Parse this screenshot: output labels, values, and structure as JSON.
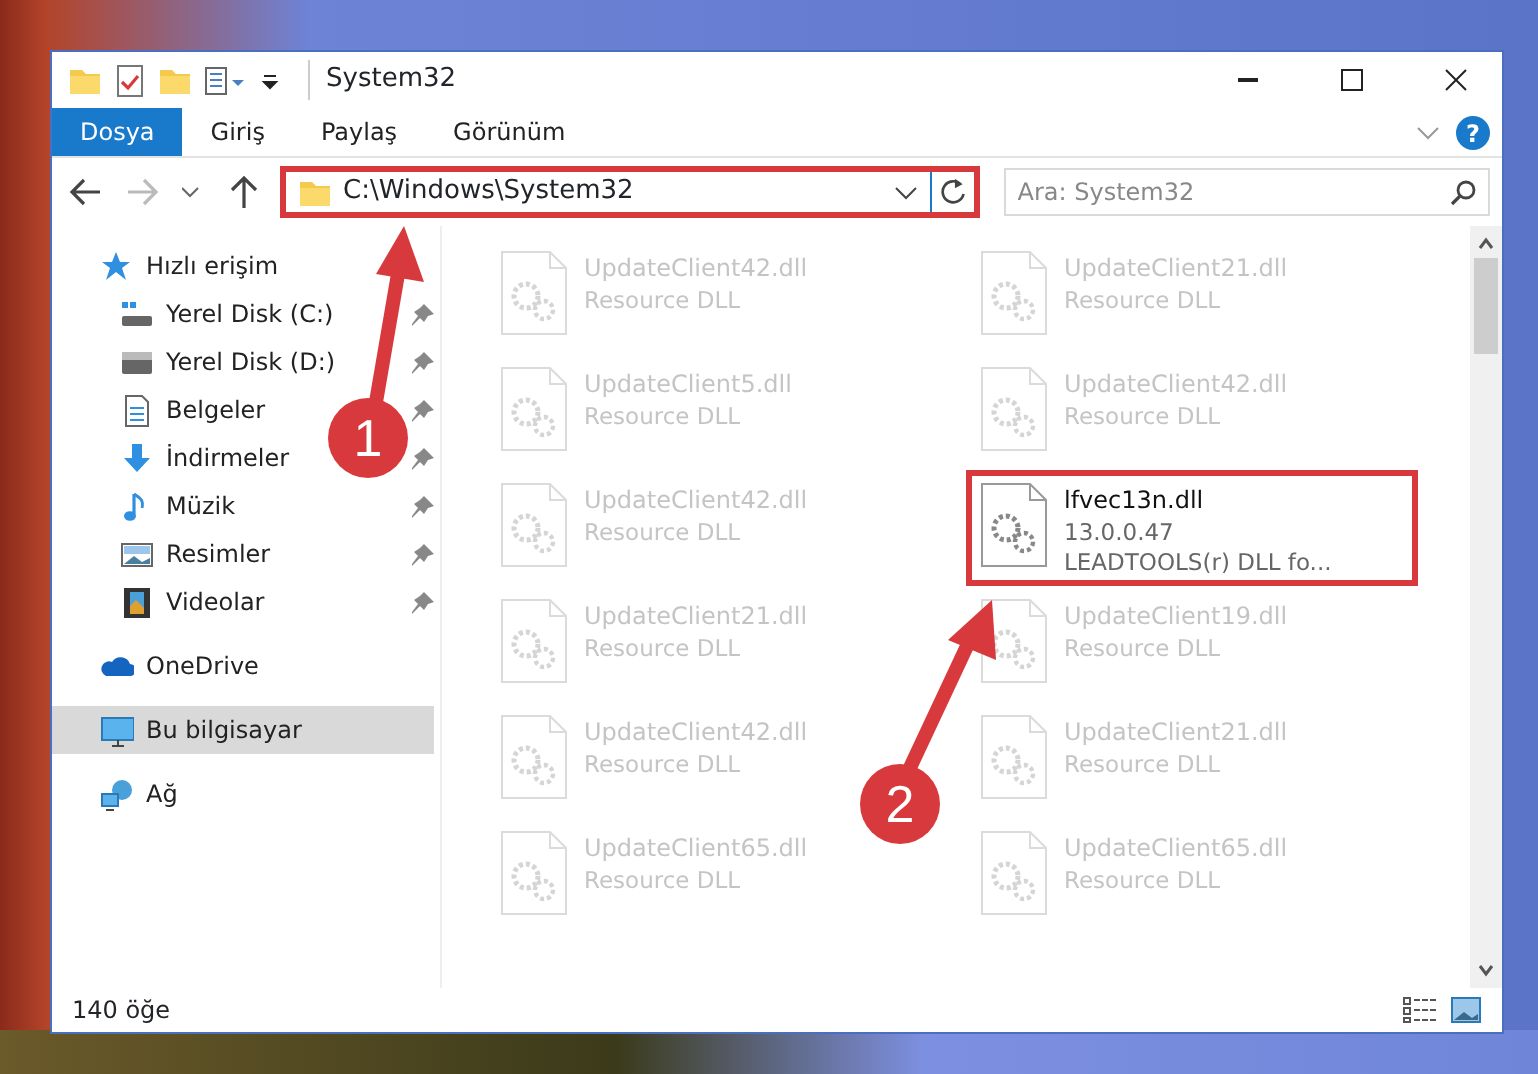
{
  "window": {
    "title": "System32"
  },
  "ribbon_tabs": [
    {
      "label": "Dosya",
      "selected": true
    },
    {
      "label": "Giriş",
      "selected": false
    },
    {
      "label": "Paylaş",
      "selected": false
    },
    {
      "label": "Görünüm",
      "selected": false
    }
  ],
  "help_button": {
    "label": "?"
  },
  "address": {
    "path": "C:\\Windows\\System32",
    "highlighted": true
  },
  "search": {
    "placeholder": "Ara: System32"
  },
  "sidebar": {
    "items": [
      {
        "label": "Hızlı erişim",
        "kind": "quick",
        "selected": false,
        "children": [
          {
            "label": "Yerel Disk (C:)",
            "kind": "disk-c",
            "pinned": true,
            "selected": false
          },
          {
            "label": "Yerel Disk (D:)",
            "kind": "disk",
            "pinned": true,
            "selected": false
          },
          {
            "label": "Belgeler",
            "kind": "documents",
            "pinned": true,
            "selected": false
          },
          {
            "label": "İndirmeler",
            "kind": "downloads",
            "pinned": true,
            "selected": false
          },
          {
            "label": "Müzik",
            "kind": "music",
            "pinned": true,
            "selected": false
          },
          {
            "label": "Resimler",
            "kind": "pictures",
            "pinned": true,
            "selected": false
          },
          {
            "label": "Videolar",
            "kind": "videos",
            "pinned": true,
            "selected": false
          }
        ]
      },
      {
        "label": "OneDrive",
        "kind": "cloud",
        "selected": false
      },
      {
        "label": "Bu bilgisayar",
        "kind": "computer",
        "selected": true
      },
      {
        "label": "Ağ",
        "kind": "network",
        "selected": false
      }
    ]
  },
  "files": [
    {
      "name": "UpdateClient42.dll",
      "description": "Resource DLL",
      "dimmed": true,
      "highlighted": false
    },
    {
      "name": "UpdateClient21.dll",
      "description": "Resource DLL",
      "dimmed": true,
      "highlighted": false
    },
    {
      "name": "UpdateClient5.dll",
      "description": "Resource DLL",
      "dimmed": true,
      "highlighted": false
    },
    {
      "name": "UpdateClient42.dll",
      "description": "Resource DLL",
      "dimmed": true,
      "highlighted": false
    },
    {
      "name": "UpdateClient42.dll",
      "description": "Resource DLL",
      "dimmed": true,
      "highlighted": false
    },
    {
      "name": "lfvec13n.dll",
      "version": "13.0.0.47",
      "description": "LEADTOOLS(r) DLL fo...",
      "dimmed": false,
      "highlighted": true
    },
    {
      "name": "UpdateClient21.dll",
      "description": "Resource DLL",
      "dimmed": true,
      "highlighted": false
    },
    {
      "name": "UpdateClient19.dll",
      "description": "Resource DLL",
      "dimmed": true,
      "highlighted": false
    },
    {
      "name": "UpdateClient42.dll",
      "description": "Resource DLL",
      "dimmed": true,
      "highlighted": false
    },
    {
      "name": "UpdateClient21.dll",
      "description": "Resource DLL",
      "dimmed": true,
      "highlighted": false
    },
    {
      "name": "UpdateClient65.dll",
      "description": "Resource DLL",
      "dimmed": true,
      "highlighted": false
    },
    {
      "name": "UpdateClient65.dll",
      "description": "Resource DLL",
      "dimmed": true,
      "highlighted": false
    }
  ],
  "status_bar": {
    "item_count": "140 öğe"
  },
  "annotations": [
    {
      "number": "1"
    },
    {
      "number": "2"
    }
  ]
}
